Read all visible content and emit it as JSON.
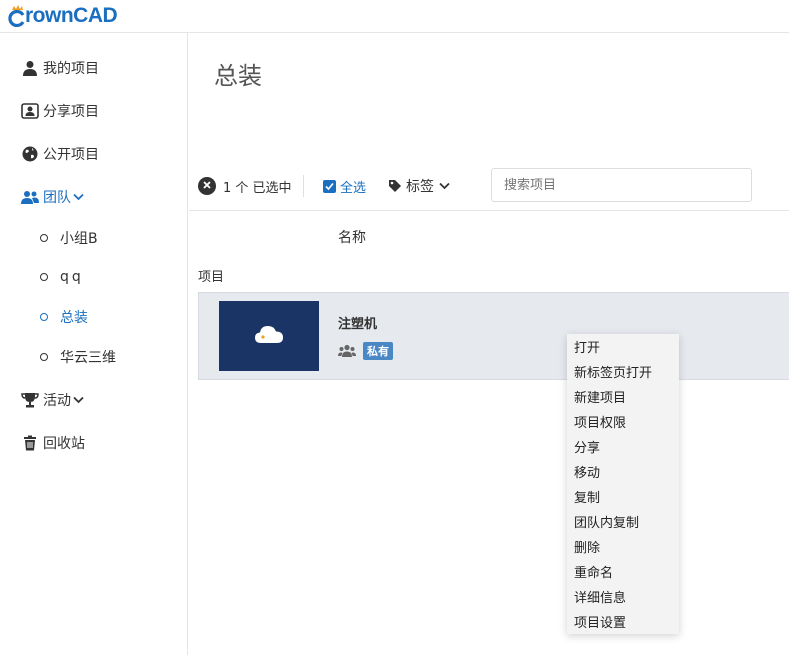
{
  "app": {
    "logo_text": "rownCAD",
    "brand_color": "#1b6fc0"
  },
  "sidebar": {
    "items": [
      {
        "label": "我的项目",
        "icon": "user-icon"
      },
      {
        "label": "分享项目",
        "icon": "shared-user-icon"
      },
      {
        "label": "公开项目",
        "icon": "globe-icon"
      },
      {
        "label": "团队",
        "icon": "team-icon",
        "expanded": true,
        "active": true
      },
      {
        "label": "活动",
        "icon": "trophy-icon"
      },
      {
        "label": "回收站",
        "icon": "trash-icon"
      }
    ],
    "team_groups": [
      {
        "label": "小组B",
        "active": false
      },
      {
        "label": "qq",
        "active": false
      },
      {
        "label": "总装",
        "active": true
      },
      {
        "label": "华云三维",
        "active": false
      }
    ]
  },
  "main": {
    "title": "总装",
    "toolbar": {
      "selected_count": "1 个 已选中",
      "select_all_label": "全选",
      "select_all_checked": true,
      "tags_label": "标签",
      "search_placeholder": "搜索项目"
    },
    "column_name": "名称",
    "section_label": "项目",
    "projects": [
      {
        "name": "注塑机",
        "badge": "私有",
        "thumbnail_icon": "cloud-icon"
      }
    ]
  },
  "context_menu": {
    "items": [
      "打开",
      "新标签页打开",
      "新建项目",
      "项目权限",
      "分享",
      "移动",
      "复制",
      "团队内复制",
      "删除",
      "重命名",
      "详细信息",
      "项目设置"
    ]
  }
}
